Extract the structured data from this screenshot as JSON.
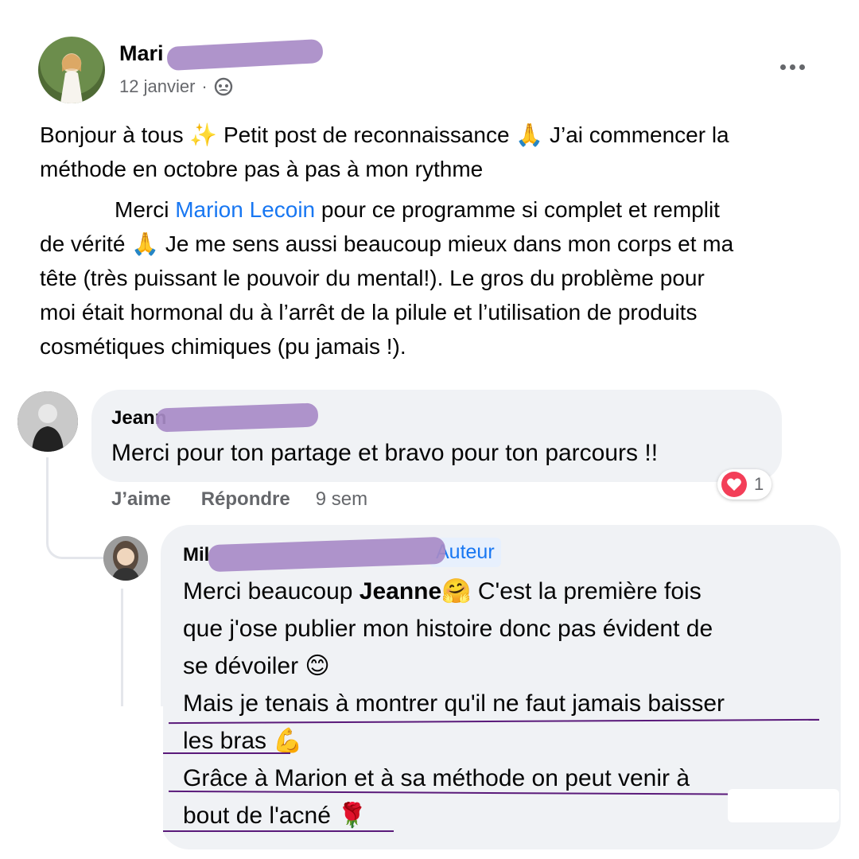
{
  "post": {
    "author_visible": "Mari",
    "date": "12 janvier",
    "date_sep": "·",
    "audience_icon": "friends-icon",
    "more_icon": "more-options-icon",
    "paragraph1_a": "Bonjour à tous ",
    "paragraph1_b": " Petit post de reconnaissance ",
    "paragraph1_c": " J’ai commencer la",
    "paragraph1_line2": "méthode en octobre pas à pas à mon rythme",
    "paragraph2_a": "Merci ",
    "paragraph2_mention": "Marion Lecoin",
    "paragraph2_b": " pour ce programme si complet et remplit",
    "paragraph2_line2a": "de vérité ",
    "paragraph2_line2b": " Je me sens aussi beaucoup mieux dans mon corps et ma",
    "paragraph2_line3": "tête (très puissant le pouvoir du mental!). Le gros du problème pour",
    "paragraph2_line4": "moi était hormonal du à l’arrêt de la pilule et l’utilisation de produits",
    "paragraph2_line5": "cosmétiques chimiques (pu jamais !).",
    "emoji_sparkles": "✨",
    "emoji_pray": "🙏"
  },
  "comment1": {
    "name_visible": "Jeann",
    "text": "Merci pour ton partage et bravo pour ton parcours !!",
    "like_label": "J’aime",
    "reply_label": "Répondre",
    "time": "9 sem",
    "reaction_icon": "love-reaction-icon",
    "reaction_count": "1"
  },
  "reply1": {
    "name_visible": "Mil",
    "badge": "Auteur",
    "line1_a": "Merci beaucoup ",
    "line1_bold": "Jeanne",
    "line1_emoji": "🤗",
    "line1_b": " C'est la première fois",
    "line2": "que j'ose publier mon histoire donc pas évident de",
    "line3": "se dévoiler ",
    "line3_emoji": "😊",
    "line4": "Mais je tenais à montrer qu'il ne faut jamais baisser",
    "line5": "les bras ",
    "line5_emoji": "💪",
    "line6": "Grâce à Marion et à sa méthode on peut venir à",
    "line7": "bout de l'acné ",
    "line7_emoji": "🌹"
  },
  "colors": {
    "mention": "#1877f2",
    "bubble": "#f0f2f5",
    "redaction": "#a88bc7",
    "muted": "#65676b",
    "love": "#f33e58"
  }
}
